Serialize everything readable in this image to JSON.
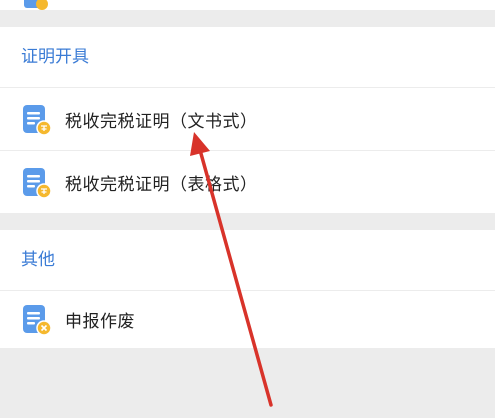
{
  "sections": [
    {
      "title": "证明开具",
      "items": [
        {
          "label": "税收完税证明（文书式）",
          "badge": "certificate-badge"
        },
        {
          "label": "税收完税证明（表格式）",
          "badge": "certificate-badge"
        }
      ]
    },
    {
      "title": "其他",
      "items": [
        {
          "label": "申报作废",
          "badge": "cancel-badge"
        }
      ]
    }
  ],
  "colors": {
    "accent": "#3a7bd5",
    "icon_blue": "#5b9bea",
    "badge_yellow": "#f5b82e",
    "arrow_red": "#d8332a",
    "background": "#ececec"
  }
}
